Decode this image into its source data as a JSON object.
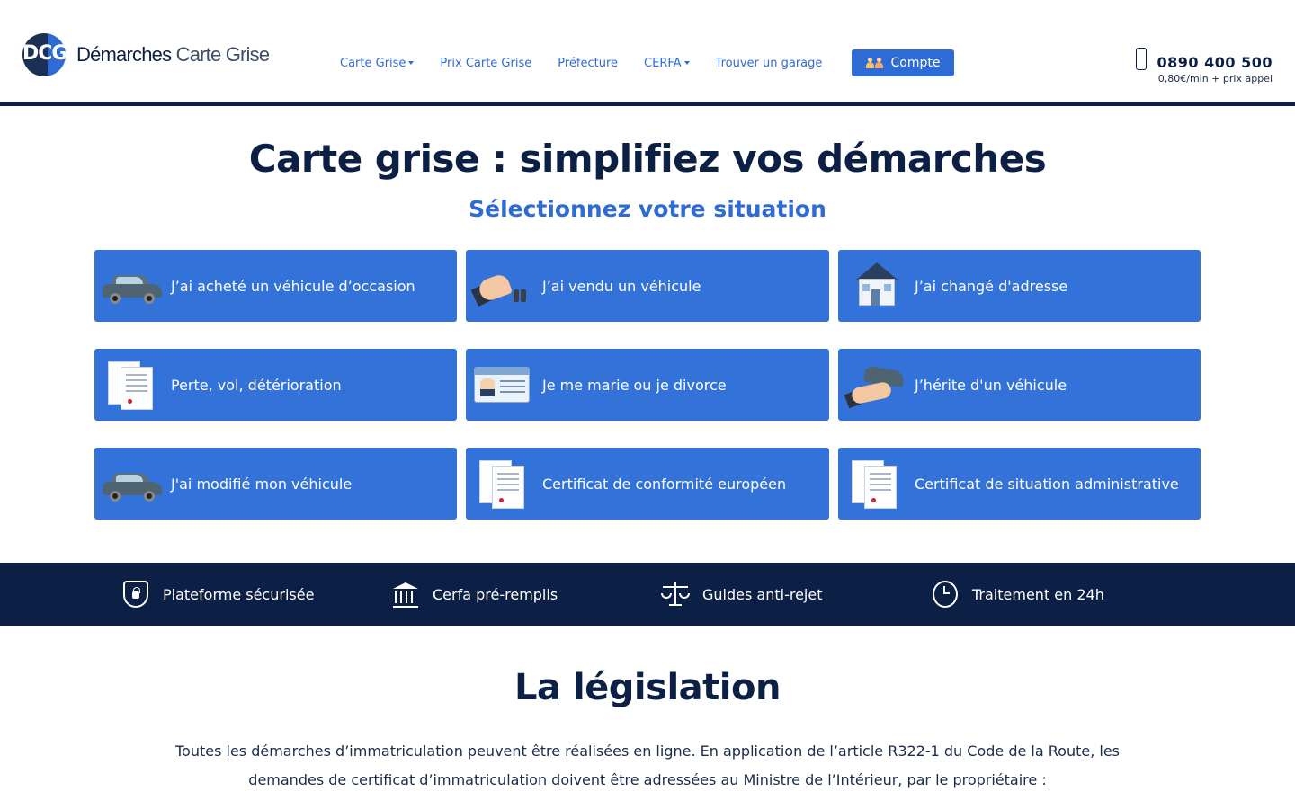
{
  "header": {
    "logo_badge": "DCG",
    "logo_word1": "Démarches",
    "logo_word2": "Carte Grise",
    "nav": [
      {
        "label": "Carte Grise",
        "dropdown": true
      },
      {
        "label": "Prix Carte Grise",
        "dropdown": false
      },
      {
        "label": "Préfecture",
        "dropdown": false
      },
      {
        "label": "CERFA",
        "dropdown": true
      },
      {
        "label": "Trouver un garage",
        "dropdown": false
      }
    ],
    "account_button": "Compte",
    "phone_number": "0890 400 500",
    "phone_price": "0,80€/min + prix appel"
  },
  "hero": {
    "title": "Carte grise : simplifiez vos démarches",
    "subtitle": "Sélectionnez votre situation"
  },
  "situations": [
    {
      "label": "J’ai acheté un véhicule d’occasion",
      "icon": "car-icon"
    },
    {
      "label": "J’ai vendu un véhicule",
      "icon": "car-keys-icon"
    },
    {
      "label": "J’ai changé d'adresse",
      "icon": "house-icon"
    },
    {
      "label": "Perte, vol, détérioration",
      "icon": "documents-icon"
    },
    {
      "label": "Je me marie ou je divorce",
      "icon": "id-card-icon"
    },
    {
      "label": "J’hérite d'un véhicule",
      "icon": "hand-car-icon"
    },
    {
      "label": "J'ai modifié mon véhicule",
      "icon": "car-icon"
    },
    {
      "label": "Certificat de conformité européen",
      "icon": "documents-icon"
    },
    {
      "label": "Certificat de situation administrative",
      "icon": "documents-icon"
    }
  ],
  "features": [
    {
      "label": "Plateforme sécurisée",
      "icon": "shield-lock-icon"
    },
    {
      "label": "Cerfa pré-remplis",
      "icon": "institution-icon"
    },
    {
      "label": "Guides anti-rejet",
      "icon": "scale-icon"
    },
    {
      "label": "Traitement en 24h",
      "icon": "clock-icon"
    }
  ],
  "legislation": {
    "title": "La législation",
    "text": "Toutes les démarches d’immatriculation peuvent être réalisées en ligne. En application de l’article R322-1 du Code de la Route, les demandes de certificat d’immatriculation doivent être adressées au Ministre de l’Intérieur, par le propriétaire :"
  },
  "colors": {
    "navy": "#0c1f44",
    "accent_blue": "#2f6bd4",
    "card_blue": "#3372d8"
  }
}
